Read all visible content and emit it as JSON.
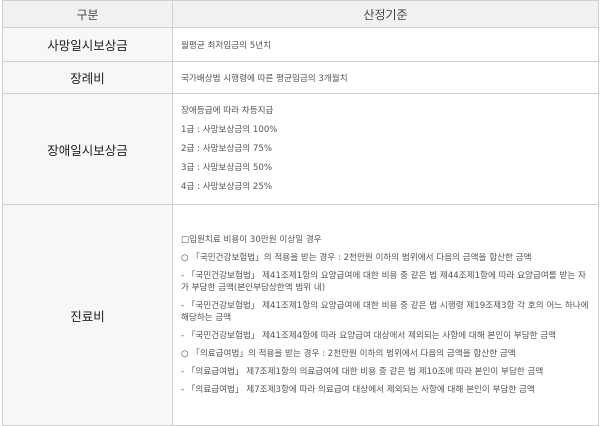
{
  "header": {
    "col1": "구분",
    "col2": "산정기준"
  },
  "rows": [
    {
      "label": "사망일시보상금",
      "content": "월평균 최저임금의 5년치"
    },
    {
      "label": "장례비",
      "content": "국가배상법 시행령에 따른 평균임금의 3개월치"
    },
    {
      "label": "장애일시보상금",
      "lines": [
        "장애등급에 따라 차등지급",
        "1급 : 사망보상금의 100%",
        "2급 : 사망보상금의 75%",
        "3급 : 사망보상금의 50%",
        "4급 : 사망보상금의 25%"
      ]
    },
    {
      "label": "진료비",
      "lines": [
        "□입원치료 비용이 30만원 이상일 경우",
        "○ 「국민건강보험법」의 적용을 받는 경우 : 2천만원 이하의 범위에서 다음의 금액을 합산한 금액",
        "- 「국민건강보험법」 제41조제1항의 요양급여에 대한 비용 중 같은 법 제44조제1항에 따라 요양급여를 받는 자가 부담한 금액(본인부담상한액 범위 내)",
        "- 「국민건강보험법」 제41조제1항의 요양급여에 대한 비용 중 같은 법 시행령 제19조제3항 각 호의 어느 하나에 해당하는 금액",
        "- 「국민건강보험법」 제41조제4항에 따라 요양급여 대상에서 제외되는 사항에 대해 본인이 부담한 금액",
        "○ 「의료급여법」의 적용을 받는 경우 : 2천만원 이하의 범위에서 다음의 금액을 합산한 금액",
        "- 「의료급여법」 제7조제1항의 의료급여에 대한 비용 중 같은 법 제10조에 따라 본인이 부담한 금액",
        "- 「의료급여법」 제7조제3항에 따라 의료급여 대상에서 제외되는 사항에 대해 본인이 부담한 금액"
      ]
    }
  ]
}
